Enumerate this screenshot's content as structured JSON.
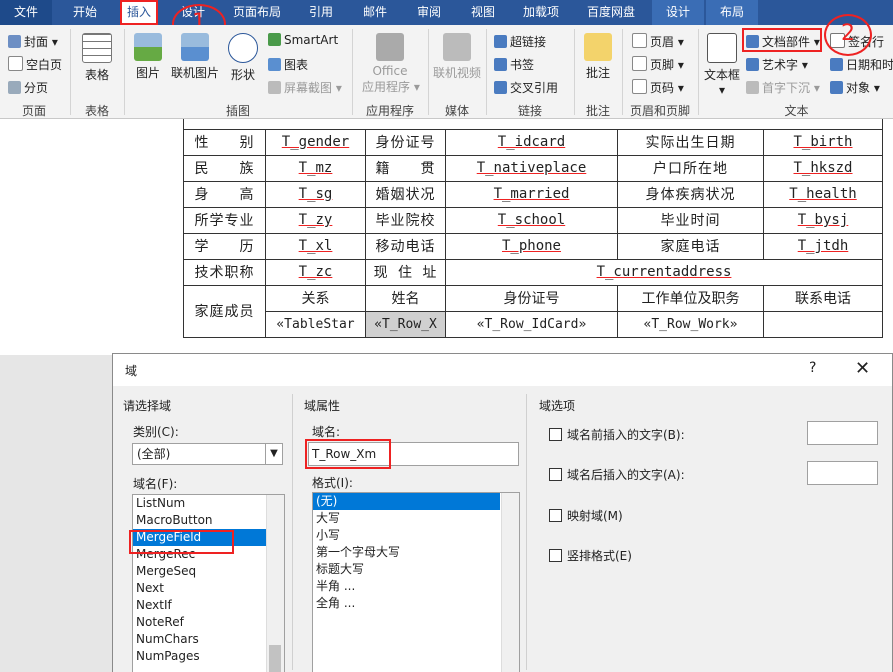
{
  "tabs": [
    "文件",
    "开始",
    "插入",
    "设计",
    "页面布局",
    "引用",
    "邮件",
    "审阅",
    "视图",
    "加载项",
    "百度网盘",
    "设计",
    "布局"
  ],
  "annotations": {
    "one": "1",
    "two": "2"
  },
  "ribbon": {
    "pages": {
      "cover": "封面",
      "blank": "空白页",
      "break": "分页",
      "label": "页面"
    },
    "table": {
      "table": "表格",
      "label": "表格"
    },
    "illus": {
      "picture": "图片",
      "online_picture": "联机图片",
      "shapes": "形状",
      "smartart": "SmartArt",
      "chart": "图表",
      "screenshot": "屏幕截图",
      "label": "插图"
    },
    "apps": {
      "office_store": "Office",
      "office_apps": "应用程序",
      "label": "应用程序"
    },
    "media": {
      "online_video": "联机视频",
      "label": "媒体"
    },
    "links": {
      "hyperlink": "超链接",
      "bookmark": "书签",
      "cross_ref": "交叉引用",
      "label": "链接"
    },
    "comments": {
      "comment": "批注",
      "label": "批注"
    },
    "header_footer": {
      "header": "页眉",
      "footer": "页脚",
      "page_number": "页码",
      "label": "页眉和页脚"
    },
    "text": {
      "textbox": "文本框",
      "quick_parts": "文档部件",
      "wordart": "艺术字",
      "dropcap": "首字下沉",
      "signature": "签名行",
      "datetime": "日期和时",
      "object": "对象",
      "label": "文本"
    }
  },
  "doc_table": {
    "rows": [
      [
        "性　　别",
        "T_gender",
        "身份证号",
        "T_idcard",
        "实际出生日期",
        "T_birth"
      ],
      [
        "民　　族",
        "T_mz",
        "籍　　贯",
        "T_nativeplace",
        "户口所在地",
        "T_hkszd"
      ],
      [
        "身　　高",
        "T_sg",
        "婚姻状况",
        "T_married",
        "身体疾病状况",
        "T_health"
      ],
      [
        "所学专业",
        "T_zy",
        "毕业院校",
        "T_school",
        "毕业时间",
        "T_bysj"
      ],
      [
        "学　　历",
        "T_xl",
        "移动电话",
        "T_phone",
        "家庭电话",
        "T_jtdh"
      ]
    ],
    "title_label": "技术职称",
    "title_value": "T_zc",
    "address_label": "现 住 址",
    "address_value": "T_currentaddress",
    "family_label": "家庭成员",
    "family_headers": [
      "关系",
      "姓名",
      "身份证号",
      "工作单位及职务",
      "联系电话"
    ],
    "family_fields": [
      "«TableStar",
      "«T_Row_X",
      "«T_Row_IdCard»",
      "«T_Row_Work»",
      ""
    ]
  },
  "dialog": {
    "title": "域",
    "help": "?",
    "close": "✕",
    "select_field_title": "请选择域",
    "category_label": "类别(C):",
    "category_value": "(全部)",
    "field_names_label": "域名(F):",
    "field_names": [
      "ListNum",
      "MacroButton",
      "MergeField",
      "MergeRec",
      "MergeSeq",
      "Next",
      "NextIf",
      "NoteRef",
      "NumChars",
      "NumPages"
    ],
    "selected_field": "MergeField",
    "props_title": "域属性",
    "field_name_label": "域名:",
    "field_name_value": "T_Row_Xm",
    "format_label": "格式(I):",
    "formats": [
      "(无)",
      "大写",
      "小写",
      "第一个字母大写",
      "标题大写",
      "半角 ...",
      "全角 ..."
    ],
    "selected_format": "(无)",
    "options_title": "域选项",
    "opt_before": "域名前插入的文字(B):",
    "opt_after": "域名后插入的文字(A):",
    "opt_mapped": "映射域(M)",
    "opt_vertical": "竖排格式(E)"
  }
}
